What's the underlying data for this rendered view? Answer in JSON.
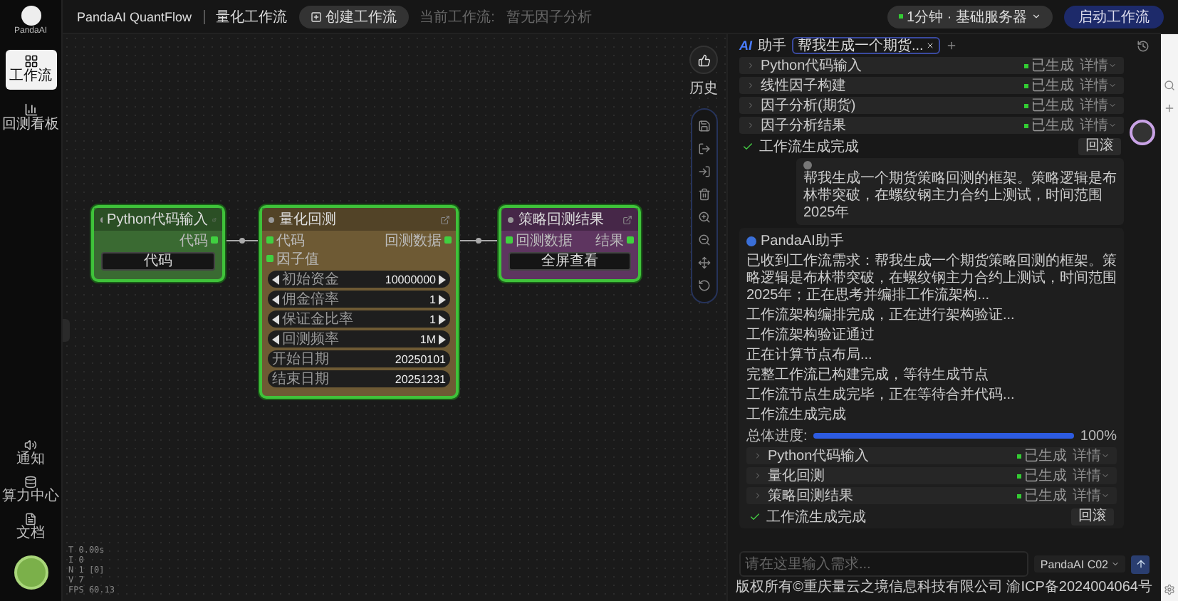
{
  "app": {
    "logo_label": "PandaAI",
    "title": "PandaAI QuantFlow",
    "subtitle": "量化工作流",
    "create_button": "创建工作流",
    "current_label": "当前工作流:",
    "current_value": "暂无因子分析",
    "server_select": "1分钟 · 基础服务器",
    "run_button": "启动工作流"
  },
  "sidebar": {
    "items": [
      {
        "label": "工作流",
        "selected": true
      },
      {
        "label": "回测看板",
        "selected": false
      }
    ],
    "bottom_items": [
      {
        "kind": "notice",
        "label": "通知"
      },
      {
        "kind": "compute",
        "label": "算力中心"
      },
      {
        "kind": "docs",
        "label": "文档"
      }
    ],
    "stats": [
      "T 0.00s",
      "I 0",
      "N 1 [0]",
      "V 7",
      "FPS 60.13"
    ]
  },
  "canvas": {
    "history_label": "历史",
    "nodes": [
      {
        "title": "Python代码输入",
        "color": "#3a6a32",
        "outputs": [
          "代码"
        ],
        "button": "代码"
      },
      {
        "title": "量化回测",
        "color": "#6e5a34",
        "inputs": [
          "代码",
          "因子值"
        ],
        "outputs": [
          "回测数据"
        ],
        "params": [
          {
            "kind": "stepper",
            "label": "初始资金",
            "value": "10000000"
          },
          {
            "kind": "stepper",
            "label": "佣金倍率",
            "value": "1"
          },
          {
            "kind": "stepper",
            "label": "保证金比率",
            "value": "1"
          },
          {
            "kind": "stepper",
            "label": "回测频率",
            "value": "1M"
          },
          {
            "kind": "date",
            "label": "开始日期",
            "value": "20250101"
          },
          {
            "kind": "date",
            "label": "结束日期",
            "value": "20251231"
          }
        ]
      },
      {
        "title": "策略回测结果",
        "color": "#5e3560",
        "inputs": [
          "回测数据"
        ],
        "outputs": [
          "结果"
        ],
        "button": "全屏查看"
      }
    ]
  },
  "chat": {
    "ai_mark": "AI",
    "title": "助手",
    "tab": "帮我生成一个期货...",
    "earlier": {
      "steps": [
        {
          "name": "Python代码输入",
          "status": "已生成",
          "detail": "详情"
        },
        {
          "name": "线性因子构建",
          "status": "已生成",
          "detail": "详情"
        },
        {
          "name": "因子分析(期货)",
          "status": "已生成",
          "detail": "详情"
        },
        {
          "name": "因子分析结果",
          "status": "已生成",
          "detail": "详情"
        }
      ],
      "status": "工作流生成完成",
      "action": "回滚"
    },
    "user_message": "帮我生成一个期货策略回测的框架。策略逻辑是布林带突破，在螺纹钢主力合约上测试，时间范围2025年",
    "reply": {
      "name": "PandaAI助手",
      "lines": [
        "已收到工作流需求：帮我生成一个期货策略回测的框架。策略逻辑是布林带突破，在螺纹钢主力合约上测试，时间范围2025年；正在思考并编排工作流架构...",
        "工作流架构编排完成，正在进行架构验证...",
        "工作流架构验证通过",
        "正在计算节点布局...",
        "完整工作流已构建完成，等待生成节点",
        "工作流节点生成完毕，正在等待合并代码...",
        "工作流生成完成"
      ],
      "progress": {
        "label": "总体进度:",
        "level": 1,
        "reading": "100%"
      },
      "steps": [
        {
          "name": "Python代码输入",
          "status": "已生成",
          "detail": "详情"
        },
        {
          "name": "量化回测",
          "status": "已生成",
          "detail": "详情"
        },
        {
          "name": "策略回测结果",
          "status": "已生成",
          "detail": "详情"
        }
      ],
      "status": "工作流生成完成",
      "action": "回滚"
    },
    "input": {
      "placeholder": "请在这里输入需求..."
    },
    "model": "PandaAI C02"
  },
  "footer": "版权所有©重庆量云之境信息科技有限公司 渝ICP备2024004064号"
}
